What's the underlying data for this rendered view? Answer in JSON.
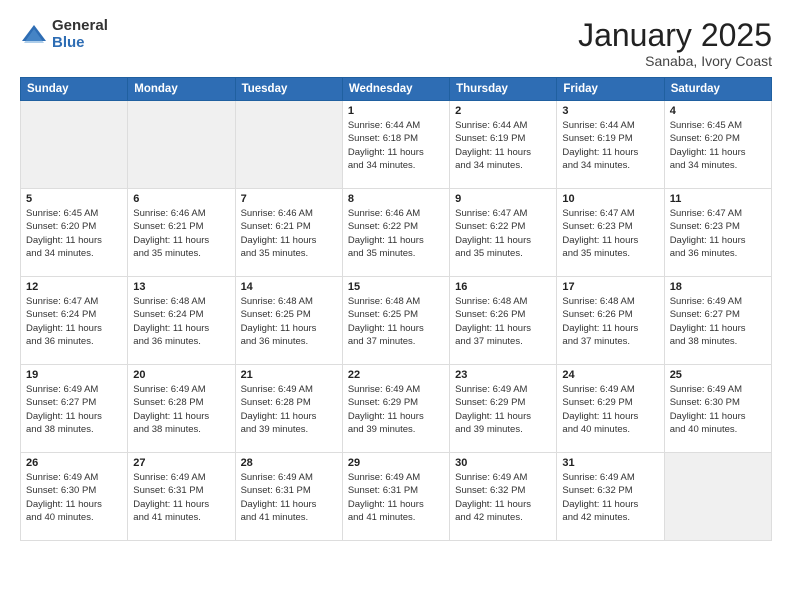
{
  "logo": {
    "general": "General",
    "blue": "Blue"
  },
  "header": {
    "month": "January 2025",
    "location": "Sanaba, Ivory Coast"
  },
  "weekdays": [
    "Sunday",
    "Monday",
    "Tuesday",
    "Wednesday",
    "Thursday",
    "Friday",
    "Saturday"
  ],
  "weeks": [
    [
      {
        "day": "",
        "info": ""
      },
      {
        "day": "",
        "info": ""
      },
      {
        "day": "",
        "info": ""
      },
      {
        "day": "1",
        "info": "Sunrise: 6:44 AM\nSunset: 6:18 PM\nDaylight: 11 hours\nand 34 minutes."
      },
      {
        "day": "2",
        "info": "Sunrise: 6:44 AM\nSunset: 6:19 PM\nDaylight: 11 hours\nand 34 minutes."
      },
      {
        "day": "3",
        "info": "Sunrise: 6:44 AM\nSunset: 6:19 PM\nDaylight: 11 hours\nand 34 minutes."
      },
      {
        "day": "4",
        "info": "Sunrise: 6:45 AM\nSunset: 6:20 PM\nDaylight: 11 hours\nand 34 minutes."
      }
    ],
    [
      {
        "day": "5",
        "info": "Sunrise: 6:45 AM\nSunset: 6:20 PM\nDaylight: 11 hours\nand 34 minutes."
      },
      {
        "day": "6",
        "info": "Sunrise: 6:46 AM\nSunset: 6:21 PM\nDaylight: 11 hours\nand 35 minutes."
      },
      {
        "day": "7",
        "info": "Sunrise: 6:46 AM\nSunset: 6:21 PM\nDaylight: 11 hours\nand 35 minutes."
      },
      {
        "day": "8",
        "info": "Sunrise: 6:46 AM\nSunset: 6:22 PM\nDaylight: 11 hours\nand 35 minutes."
      },
      {
        "day": "9",
        "info": "Sunrise: 6:47 AM\nSunset: 6:22 PM\nDaylight: 11 hours\nand 35 minutes."
      },
      {
        "day": "10",
        "info": "Sunrise: 6:47 AM\nSunset: 6:23 PM\nDaylight: 11 hours\nand 35 minutes."
      },
      {
        "day": "11",
        "info": "Sunrise: 6:47 AM\nSunset: 6:23 PM\nDaylight: 11 hours\nand 36 minutes."
      }
    ],
    [
      {
        "day": "12",
        "info": "Sunrise: 6:47 AM\nSunset: 6:24 PM\nDaylight: 11 hours\nand 36 minutes."
      },
      {
        "day": "13",
        "info": "Sunrise: 6:48 AM\nSunset: 6:24 PM\nDaylight: 11 hours\nand 36 minutes."
      },
      {
        "day": "14",
        "info": "Sunrise: 6:48 AM\nSunset: 6:25 PM\nDaylight: 11 hours\nand 36 minutes."
      },
      {
        "day": "15",
        "info": "Sunrise: 6:48 AM\nSunset: 6:25 PM\nDaylight: 11 hours\nand 37 minutes."
      },
      {
        "day": "16",
        "info": "Sunrise: 6:48 AM\nSunset: 6:26 PM\nDaylight: 11 hours\nand 37 minutes."
      },
      {
        "day": "17",
        "info": "Sunrise: 6:48 AM\nSunset: 6:26 PM\nDaylight: 11 hours\nand 37 minutes."
      },
      {
        "day": "18",
        "info": "Sunrise: 6:49 AM\nSunset: 6:27 PM\nDaylight: 11 hours\nand 38 minutes."
      }
    ],
    [
      {
        "day": "19",
        "info": "Sunrise: 6:49 AM\nSunset: 6:27 PM\nDaylight: 11 hours\nand 38 minutes."
      },
      {
        "day": "20",
        "info": "Sunrise: 6:49 AM\nSunset: 6:28 PM\nDaylight: 11 hours\nand 38 minutes."
      },
      {
        "day": "21",
        "info": "Sunrise: 6:49 AM\nSunset: 6:28 PM\nDaylight: 11 hours\nand 39 minutes."
      },
      {
        "day": "22",
        "info": "Sunrise: 6:49 AM\nSunset: 6:29 PM\nDaylight: 11 hours\nand 39 minutes."
      },
      {
        "day": "23",
        "info": "Sunrise: 6:49 AM\nSunset: 6:29 PM\nDaylight: 11 hours\nand 39 minutes."
      },
      {
        "day": "24",
        "info": "Sunrise: 6:49 AM\nSunset: 6:29 PM\nDaylight: 11 hours\nand 40 minutes."
      },
      {
        "day": "25",
        "info": "Sunrise: 6:49 AM\nSunset: 6:30 PM\nDaylight: 11 hours\nand 40 minutes."
      }
    ],
    [
      {
        "day": "26",
        "info": "Sunrise: 6:49 AM\nSunset: 6:30 PM\nDaylight: 11 hours\nand 40 minutes."
      },
      {
        "day": "27",
        "info": "Sunrise: 6:49 AM\nSunset: 6:31 PM\nDaylight: 11 hours\nand 41 minutes."
      },
      {
        "day": "28",
        "info": "Sunrise: 6:49 AM\nSunset: 6:31 PM\nDaylight: 11 hours\nand 41 minutes."
      },
      {
        "day": "29",
        "info": "Sunrise: 6:49 AM\nSunset: 6:31 PM\nDaylight: 11 hours\nand 41 minutes."
      },
      {
        "day": "30",
        "info": "Sunrise: 6:49 AM\nSunset: 6:32 PM\nDaylight: 11 hours\nand 42 minutes."
      },
      {
        "day": "31",
        "info": "Sunrise: 6:49 AM\nSunset: 6:32 PM\nDaylight: 11 hours\nand 42 minutes."
      },
      {
        "day": "",
        "info": ""
      }
    ]
  ]
}
